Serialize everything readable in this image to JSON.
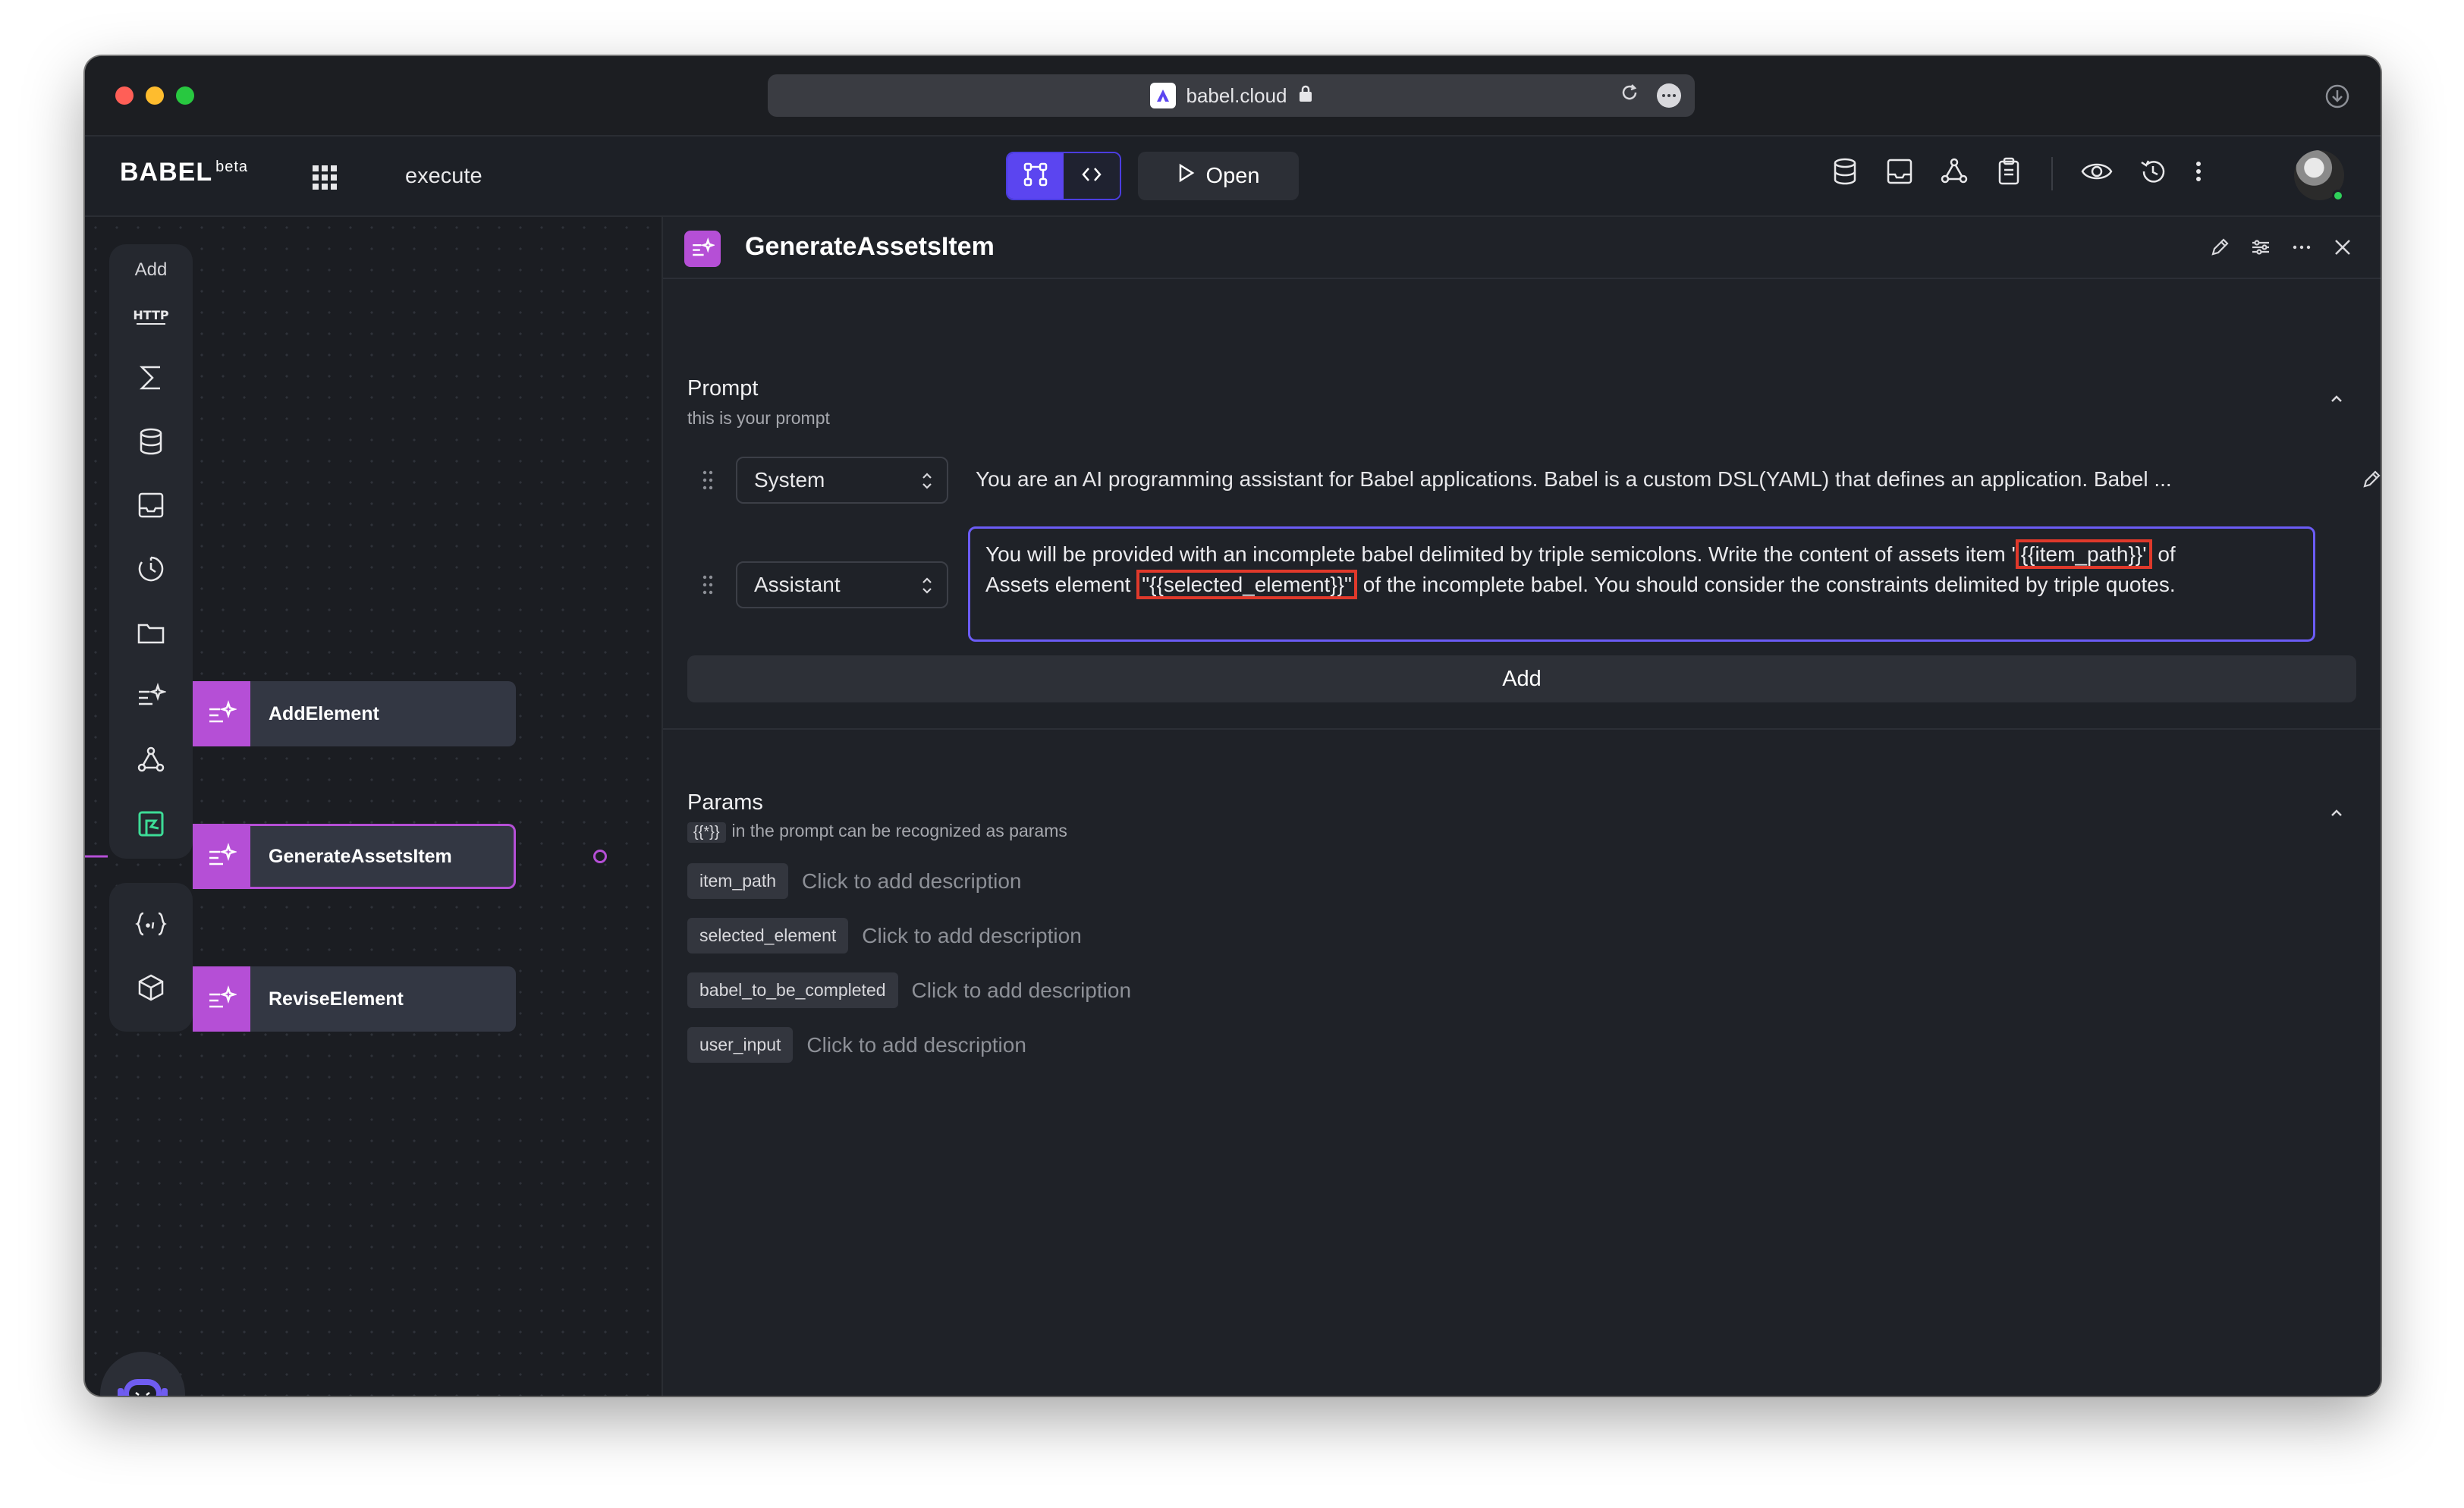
{
  "browser": {
    "url": "babel.cloud",
    "traffic_lights": {
      "close": "#ff5f57",
      "minimize": "#febc2e",
      "maximize": "#28c840"
    }
  },
  "header": {
    "logo_text": "BABEL",
    "logo_sup": "beta",
    "project_name": "execute",
    "open_label": "Open",
    "accent": "#5b45f0"
  },
  "toolbar": {
    "add_label": "Add",
    "icons": [
      "http-icon",
      "sigma-icon",
      "database-icon",
      "inbox-icon",
      "clock-icon",
      "folder-icon",
      "ai-prompt-icon",
      "triangle-graph-icon",
      "flow-icon",
      "braces-icon",
      "cube-icon"
    ]
  },
  "canvas": {
    "nodes": [
      {
        "label": "AddElement",
        "selected": false
      },
      {
        "label": "GenerateAssetsItem",
        "selected": true
      },
      {
        "label": "ReviseElement",
        "selected": false
      }
    ],
    "node_color": "#b54fd6"
  },
  "panel": {
    "title": "GenerateAssetsItem",
    "prompt": {
      "title": "Prompt",
      "subtitle": "this is your prompt",
      "messages": [
        {
          "role": "System",
          "text": "You are an AI programming assistant for Babel applications. Babel is a custom DSL(YAML) that defines an application. Babel ..."
        },
        {
          "role": "Assistant",
          "text_part1": "You will be provided with an incomplete babel delimited by triple semicolons. Write the content of assets item '",
          "param1": "{{item_path}}'",
          "text_part2": " of",
          "text_part3": "Assets element ",
          "param2": "\"{{selected_element}}\"",
          "text_part4": " of the incomplete babel. You should consider the constraints delimited by triple quotes."
        }
      ],
      "add_label": "Add"
    },
    "params": {
      "title": "Params",
      "subtitle_chip": "{{*}}",
      "subtitle": "in the prompt can be recognized as params",
      "items": [
        {
          "name": "item_path",
          "description": "Click to add description"
        },
        {
          "name": "selected_element",
          "description": "Click to add description"
        },
        {
          "name": "babel_to_be_completed",
          "description": "Click to add description"
        },
        {
          "name": "user_input",
          "description": "Click to add description"
        }
      ]
    }
  }
}
